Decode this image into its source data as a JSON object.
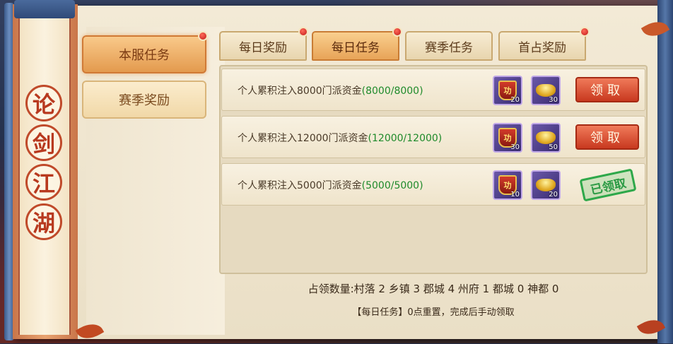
{
  "scroll": {
    "chars": [
      "论",
      "剑",
      "江",
      "湖"
    ]
  },
  "side_menu": [
    {
      "label": "本服任务",
      "active": true,
      "badge": true
    },
    {
      "label": "赛季奖励",
      "active": false,
      "badge": false
    }
  ],
  "tabs": [
    {
      "label": "每日奖励",
      "active": false,
      "badge": true
    },
    {
      "label": "每日任务",
      "active": true,
      "badge": true
    },
    {
      "label": "赛季任务",
      "active": false,
      "badge": false
    },
    {
      "label": "首占奖励",
      "active": false,
      "badge": true
    }
  ],
  "tasks": [
    {
      "text": "个人累积注入8000门派资金",
      "progress": "(8000/8000)",
      "rewards": [
        {
          "icon": "gong-medal-icon",
          "glyph": "功",
          "count": "20"
        },
        {
          "icon": "gold-ingot-icon",
          "count": "30"
        }
      ],
      "status_label": "领取",
      "claimed": false
    },
    {
      "text": "个人累积注入12000门派资金",
      "progress": "(12000/12000)",
      "rewards": [
        {
          "icon": "gong-medal-icon",
          "glyph": "功",
          "count": "30"
        },
        {
          "icon": "gold-ingot-icon",
          "count": "50"
        }
      ],
      "status_label": "领取",
      "claimed": false
    },
    {
      "text": "个人累积注入5000门派资金",
      "progress": "(5000/5000)",
      "rewards": [
        {
          "icon": "gong-medal-icon",
          "glyph": "功",
          "count": "10"
        },
        {
          "icon": "gold-ingot-icon",
          "count": "20"
        }
      ],
      "status_label": "已领取",
      "claimed": true
    }
  ],
  "footer": {
    "occupation": "占领数量:村落 2 乡镇 3 郡城 4 州府 1 都城 0 神都 0",
    "note": "【每日任务】0点重置，完成后手动领取"
  },
  "colors": {
    "progress_green": "#1e8a2a",
    "claim_red": "#c8391f",
    "claimed_green": "#2a9a44"
  }
}
